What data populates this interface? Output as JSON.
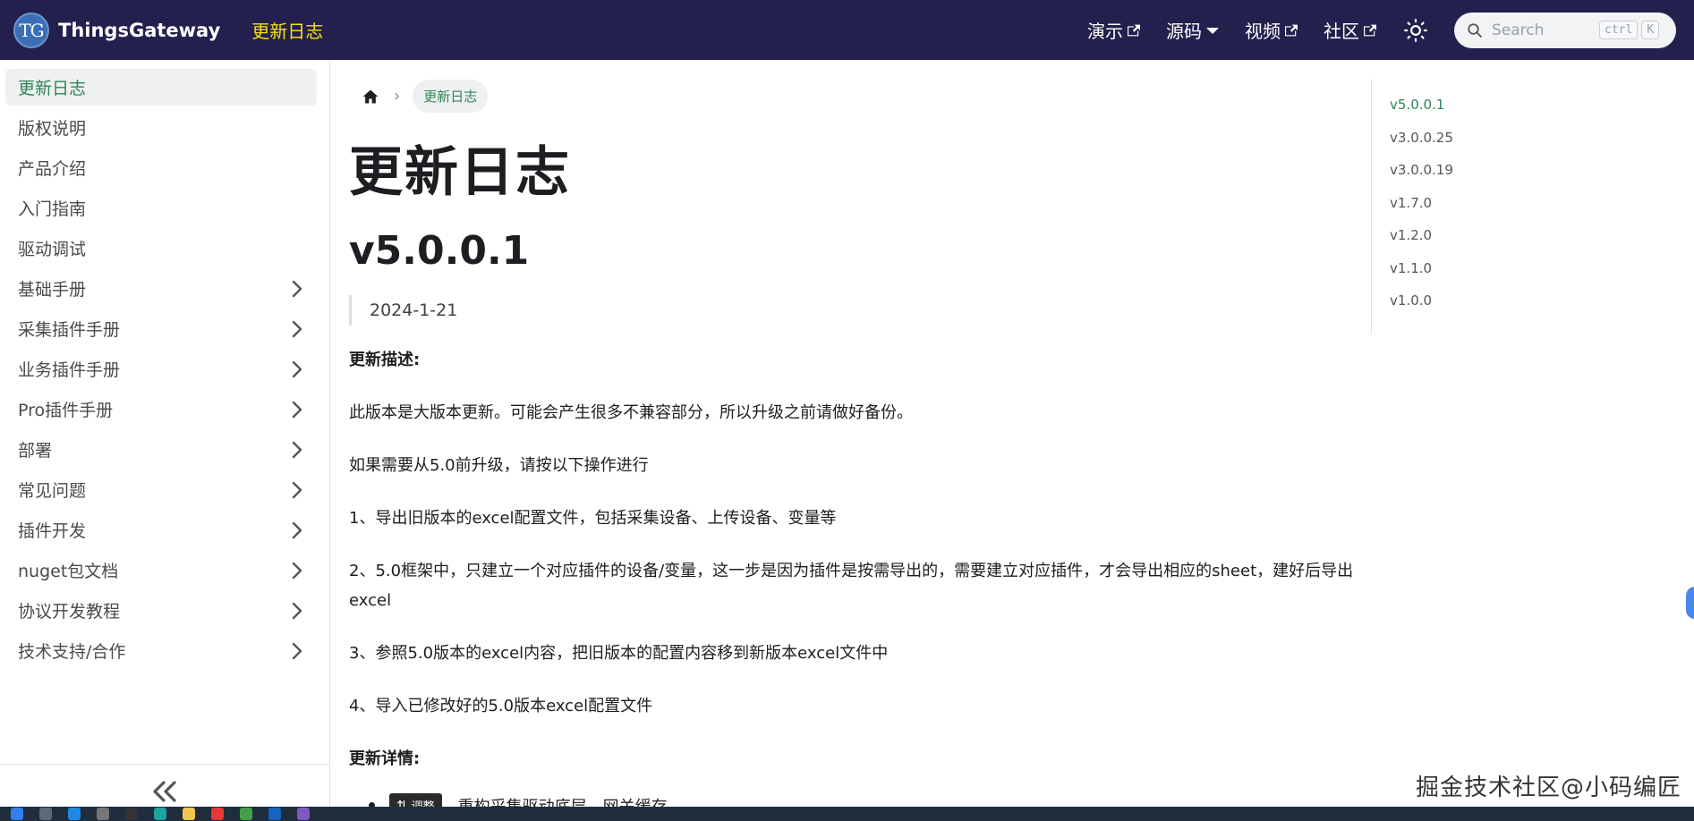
{
  "navbar": {
    "logo_text": "TG",
    "brand": "ThingsGateway",
    "active_link": "更新日志",
    "links": [
      {
        "label": "演示",
        "external": true
      },
      {
        "label": "源码",
        "dropdown": true
      },
      {
        "label": "视频",
        "external": true
      },
      {
        "label": "社区",
        "external": true
      }
    ],
    "search": {
      "placeholder": "Search",
      "key1": "ctrl",
      "key2": "K"
    }
  },
  "sidebar": {
    "items": [
      {
        "label": "更新日志",
        "active": true,
        "has_children": false
      },
      {
        "label": "版权说明",
        "has_children": false
      },
      {
        "label": "产品介绍",
        "has_children": false
      },
      {
        "label": "入门指南",
        "has_children": false
      },
      {
        "label": "驱动调试",
        "has_children": false
      },
      {
        "label": "基础手册",
        "has_children": true
      },
      {
        "label": "采集插件手册",
        "has_children": true
      },
      {
        "label": "业务插件手册",
        "has_children": true
      },
      {
        "label": "Pro插件手册",
        "has_children": true
      },
      {
        "label": "部署",
        "has_children": true
      },
      {
        "label": "常见问题",
        "has_children": true
      },
      {
        "label": "插件开发",
        "has_children": true
      },
      {
        "label": "nuget包文档",
        "has_children": true
      },
      {
        "label": "协议开发教程",
        "has_children": true
      },
      {
        "label": "技术支持/合作",
        "has_children": true
      }
    ]
  },
  "main": {
    "breadcrumb": "更新日志",
    "title": "更新日志",
    "version": "v5.0.0.1",
    "date": "2024-1-21",
    "desc_heading": "更新描述:",
    "paragraphs": [
      "此版本是大版本更新。可能会产生很多不兼容部分，所以升级之前请做好备份。",
      "如果需要从5.0前升级，请按以下操作进行",
      "1、导出旧版本的excel配置文件，包括采集设备、上传设备、变量等",
      "2、5.0框架中，只建立一个对应插件的设备/变量，这一步是因为插件是按需导出的，需要建立对应插件，才会导出相应的sheet，建好后导出excel",
      "3、参照5.0版本的excel内容，把旧版本的配置内容移到新版本excel文件中",
      "4、导入已修改好的5.0版本excel配置文件"
    ],
    "details_heading": "更新详情:",
    "details": [
      "重构采集驱动底层，网关缓存"
    ],
    "tooltip": {
      "key": "⇅",
      "label": "调整"
    }
  },
  "toc": {
    "items": [
      "v5.0.0.1",
      "v3.0.0.25",
      "v3.0.0.19",
      "v1.7.0",
      "v1.2.0",
      "v1.1.0",
      "v1.0.0"
    ]
  },
  "watermark": "掘金技术社区@小码编匠",
  "colors": {
    "navbar_bg": "#23204d",
    "nav_active": "#f5e21a",
    "accent_green": "#2e8555"
  }
}
